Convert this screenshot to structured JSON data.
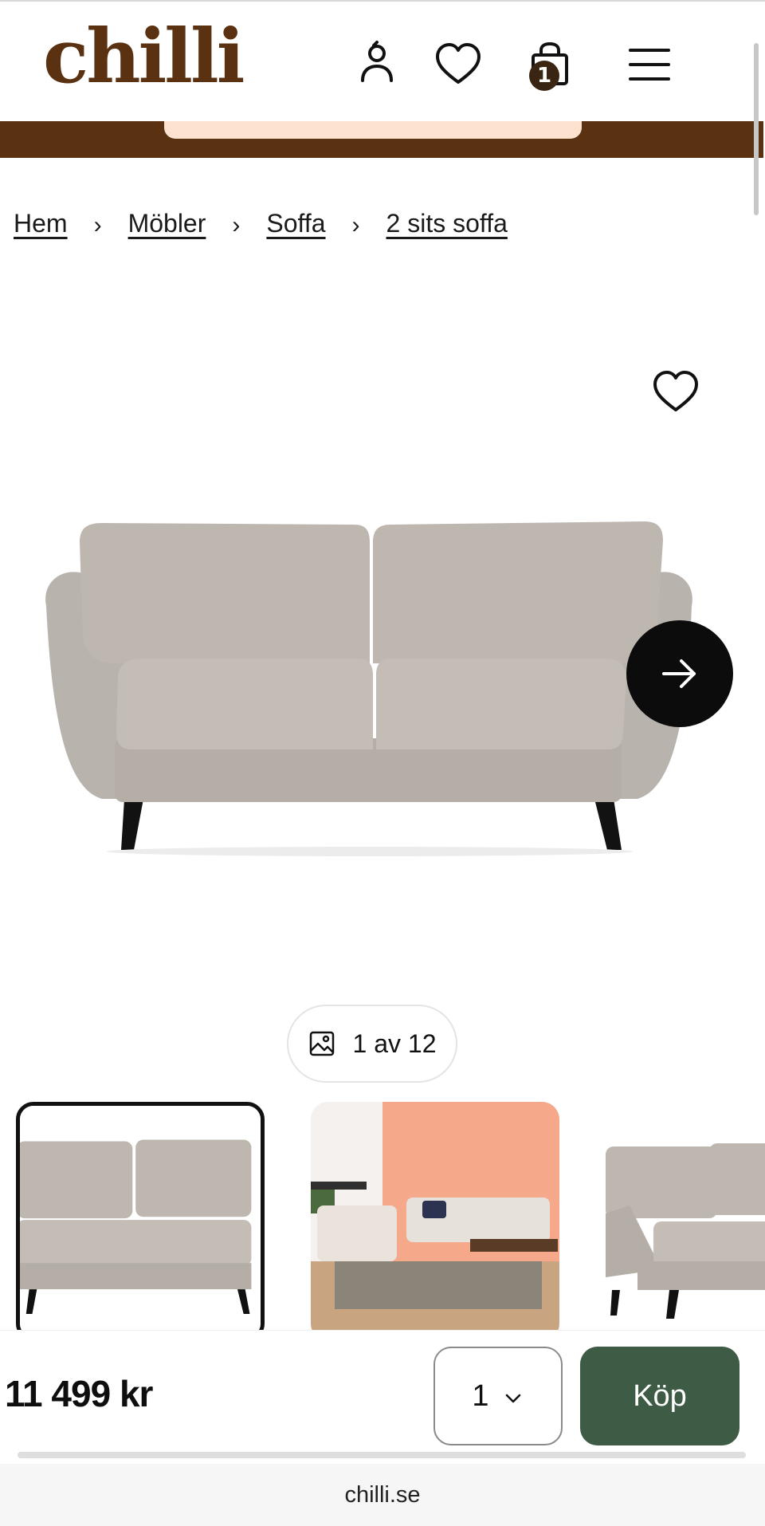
{
  "brand": {
    "logo_text": "chilli",
    "colors": {
      "brand_brown": "#5a3212",
      "promo_peach": "#fde3cf",
      "buy_green": "#3d5b45"
    }
  },
  "header": {
    "icons": [
      "account-icon",
      "heart-icon",
      "cart-icon",
      "menu-icon"
    ],
    "cart_count": "1"
  },
  "breadcrumb": {
    "items": [
      "Hem",
      "Möbler",
      "Soffa",
      "2 sits soffa"
    ],
    "separator": "›"
  },
  "gallery": {
    "counter_text": "1 av 12",
    "current": 1,
    "total": 12
  },
  "buy_bar": {
    "price": "11 499 kr",
    "quantity": "1",
    "buy_label": "Köp"
  },
  "browser": {
    "url": "chilli.se"
  }
}
